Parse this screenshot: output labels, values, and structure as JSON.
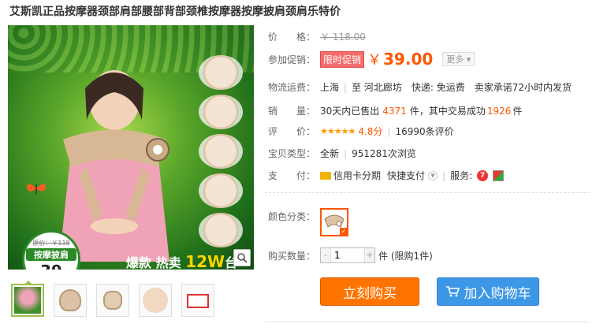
{
  "title": "艾斯凯正品按摩器颈部肩部腰部背部颈椎按摩器按摩披肩颈肩乐特价",
  "image": {
    "badge_orig": "原价：￥118",
    "badge_name": "按摩披肩",
    "badge_price": "39",
    "slogan_pre": "爆款 热卖",
    "slogan_w": "12W",
    "slogan_post": "台"
  },
  "details": {
    "price_label": "价　　格：",
    "price_value": "￥ 118.00",
    "promo_label": "参加促销：",
    "promo_tag": "限时促销",
    "promo_currency": "￥",
    "promo_price": "39.00",
    "more_label": "更多 ▾",
    "shipping_label": "物流运费：",
    "shipping_from": "上海",
    "shipping_to": "至  河北廊坊",
    "shipping_express": "快递: 免运费",
    "shipping_promise": "卖家承诺72小时内发货",
    "sales_label": "销　　量：",
    "sales_prefix": "30天内已售出",
    "sales_count": "4371",
    "sales_mid": "件，其中交易成功",
    "sales_success": "1926",
    "sales_suffix": "件",
    "rating_label": "评　　价：",
    "rating_stars": "★★★★★",
    "rating_score": "4.8分",
    "rating_count": "16990条评价",
    "type_label": "宝贝类型：",
    "type_value": "全新",
    "type_views": "951281次浏览",
    "pay_label": "支　　付：",
    "pay_installment": "信用卡分期",
    "pay_quick": "快捷支付",
    "service_label": "服务:",
    "service_icon1": "7"
  },
  "options": {
    "color_label": "颜色分类：",
    "qty_label": "购买数量：",
    "qty_value": "1",
    "qty_unit": "件 (限购1件)"
  },
  "buttons": {
    "buy_now": "立刻购买",
    "add_cart": "加入购物车"
  },
  "colors": {
    "accent_orange": "#ff5500",
    "buy_button": "#ff7300",
    "cart_button": "#3c97e6"
  }
}
